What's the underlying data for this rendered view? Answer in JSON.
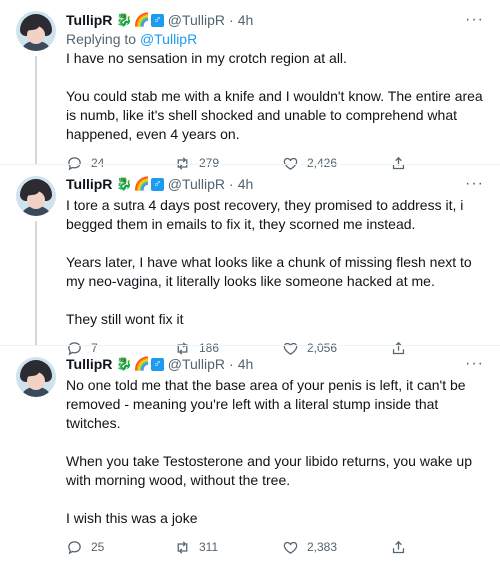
{
  "tweets": [
    {
      "name": "TullipR",
      "handle": "@TullipR",
      "time": "4h",
      "reply_prefix": "Replying to ",
      "reply_to": "@TullipR",
      "paragraphs": [
        "I have no sensation in my crotch region at all.",
        "You could stab me with a knife and I wouldn't know. The entire area is numb, like it's shell shocked and unable to comprehend what happened, even 4 years on."
      ],
      "replies": "24",
      "retweets": "279",
      "likes": "2,426"
    },
    {
      "name": "TullipR",
      "handle": "@TullipR",
      "time": "4h",
      "paragraphs": [
        "I tore a sutra 4 days post recovery, they promised to address it, i begged them in emails to fix it, they scorned me instead.",
        "Years later, I have what looks like a chunk of missing flesh next to my neo-vagina, it literally looks like someone hacked at me.",
        "They still wont fix it"
      ],
      "replies": "7",
      "retweets": "186",
      "likes": "2,056"
    },
    {
      "name": "TullipR",
      "handle": "@TullipR",
      "time": "4h",
      "paragraphs": [
        "No one told me that the base area of your penis is left, it can't be removed - meaning you're left with a literal stump inside that twitches.",
        "When you take Testosterone and your libido returns, you wake up with morning wood, without the tree.",
        "I wish this was a joke"
      ],
      "replies": "25",
      "retweets": "311",
      "likes": "2,383"
    }
  ],
  "badges": [
    "dragon-emoji",
    "rainbow-emoji",
    "male-sign-emoji"
  ],
  "dot": "·",
  "more": "···",
  "colors": {
    "accent": "#1d9bf0",
    "muted": "#536471",
    "text": "#0f1419",
    "thread": "#cfd9de"
  }
}
